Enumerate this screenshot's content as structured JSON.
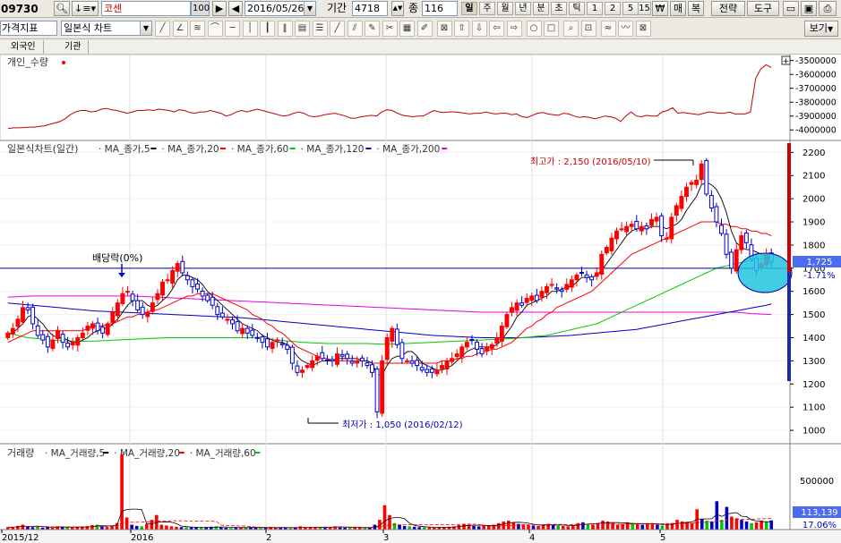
{
  "toolbar1": {
    "stock_code": "09730",
    "stock_name": "코센",
    "qty": "100",
    "date": "2016/05/26",
    "period_label": "기간",
    "period_value": "4718",
    "mid_label": "종",
    "mid_value": "116",
    "periods": [
      "일",
      "주",
      "월",
      "년",
      "분",
      "초",
      "틱",
      "1",
      "2",
      "5",
      "15"
    ],
    "selected_period": "일",
    "currency_btn": "₩",
    "buy_btn": "매",
    "complex_btn": "복",
    "strategy_btn": "전략",
    "tools_btn": "도구"
  },
  "toolbar2": {
    "indicator_label": "가격지표",
    "chart_type": "일본식 차트",
    "view_btn": "보기"
  },
  "tabs": [
    "외국인",
    "기관"
  ],
  "top_panel": {
    "legend": "개인_수량",
    "axis_labels": [
      "-3500000",
      "-3600000",
      "-3700000",
      "-3800000",
      "-3900000",
      "-4000000"
    ],
    "y_range": [
      -4050000,
      -3470000
    ],
    "series": [
      -3990000,
      -3985000,
      -3985000,
      -3983000,
      -3980000,
      -3980000,
      -3975000,
      -3970000,
      -3960000,
      -3950000,
      -3940000,
      -3920000,
      -3890000,
      -3870000,
      -3860000,
      -3860000,
      -3870000,
      -3865000,
      -3850000,
      -3845000,
      -3855000,
      -3860000,
      -3870000,
      -3880000,
      -3870000,
      -3860000,
      -3860000,
      -3855000,
      -3860000,
      -3850000,
      -3855000,
      -3860000,
      -3870000,
      -3855000,
      -3860000,
      -3875000,
      -3880000,
      -3870000,
      -3870000,
      -3860000,
      -3870000,
      -3880000,
      -3900000,
      -3890000,
      -3870000,
      -3860000,
      -3870000,
      -3860000,
      -3850000,
      -3860000,
      -3870000,
      -3880000,
      -3890000,
      -3900000,
      -3895000,
      -3880000,
      -3870000,
      -3880000,
      -3900000,
      -3905000,
      -3900000,
      -3890000,
      -3885000,
      -3880000,
      -3890000,
      -3900000,
      -3915000,
      -3915000,
      -3905000,
      -3900000,
      -3895000,
      -3900000,
      -3870000,
      -3855000,
      -3860000,
      -3880000,
      -3895000,
      -3900000,
      -3905000,
      -3900000,
      -3900000,
      -3880000,
      -3860000,
      -3870000,
      -3875000,
      -3870000,
      -3870000,
      -3875000,
      -3880000,
      -3885000,
      -3880000,
      -3880000,
      -3870000,
      -3880000,
      -3885000,
      -3880000,
      -3880000,
      -3890000,
      -3885000,
      -3905000,
      -3910000,
      -3895000,
      -3880000,
      -3875000,
      -3885000,
      -3890000,
      -3895000,
      -3880000,
      -3885000,
      -3900000,
      -3910000,
      -3905000,
      -3910000,
      -3920000,
      -3910000,
      -3900000,
      -3905000,
      -3915000,
      -3940000,
      -3900000,
      -3870000,
      -3900000,
      -3905000,
      -3895000,
      -3900000,
      -3900000,
      -3870000,
      -3860000,
      -3840000,
      -3880000,
      -3875000,
      -3880000,
      -3885000,
      -3890000,
      -3880000,
      -3870000,
      -3875000,
      -3880000,
      -3880000,
      -3870000,
      -3885000,
      -3885000,
      -3885000,
      -3870000,
      -3630000,
      -3560000,
      -3530000,
      -3550000
    ]
  },
  "price_panel": {
    "legend_title": "일본식차트(일간)",
    "ma_legend": [
      {
        "name": "MA_종가,5",
        "color": "#000000"
      },
      {
        "name": "MA_종가,20",
        "color": "#ff0000"
      },
      {
        "name": "MA_종가,60",
        "color": "#00c800"
      },
      {
        "name": "MA_종가,120",
        "color": "#0000c8"
      },
      {
        "name": "MA_종가,200",
        "color": "#e000e0"
      }
    ],
    "axis_labels": [
      "2200",
      "2100",
      "2000",
      "1900",
      "1800",
      "1700",
      "1600",
      "1500",
      "1400",
      "1300",
      "1200",
      "1100",
      "1000"
    ],
    "y_range": [
      950,
      2240
    ],
    "current_price": "1,725",
    "current_change": "-1.71%",
    "dividend_label": "배당락(0%)",
    "high_label": "최고가 : 2,150 (2016/05/10)",
    "low_label": "최저가 : 1,050 (2016/02/12)",
    "level_line": 1700
  },
  "volume_panel": {
    "legend_title": "거래량",
    "ma_legend": [
      {
        "name": "MA_거래량,5",
        "color": "#000000"
      },
      {
        "name": "MA_거래량,20",
        "color": "#ff0000"
      },
      {
        "name": "MA_거래량,60",
        "color": "#00c800"
      }
    ],
    "axis_label": "500000",
    "current_volume": "113,139",
    "current_ratio": "17.06%"
  },
  "x_axis": {
    "labels": [
      "2015/12",
      "2016",
      "2",
      "3",
      "4",
      "5"
    ]
  },
  "colors": {
    "up": "#ff0000",
    "down": "#0000c8",
    "ma5": "#000000",
    "ma20": "#ff0000",
    "ma60": "#00c800",
    "ma120": "#0000c8",
    "ma200": "#e000e0",
    "highlight": "#22c4e0"
  },
  "chart_data": {
    "type": "candlestick",
    "x_labels": [
      "2015/12",
      "2016",
      "2",
      "3",
      "4",
      "5"
    ],
    "y_range": [
      950,
      2240
    ],
    "high": {
      "value": 2150,
      "date": "2016/05/10"
    },
    "low": {
      "value": 1050,
      "date": "2016/02/12"
    },
    "close": [
      1420,
      1440,
      1480,
      1530,
      1520,
      1460,
      1410,
      1390,
      1360,
      1390,
      1430,
      1380,
      1360,
      1380,
      1400,
      1420,
      1450,
      1460,
      1430,
      1420,
      1460,
      1510,
      1550,
      1590,
      1600,
      1560,
      1520,
      1500,
      1510,
      1550,
      1590,
      1640,
      1650,
      1690,
      1720,
      1680,
      1650,
      1620,
      1610,
      1580,
      1560,
      1540,
      1500,
      1490,
      1480,
      1460,
      1430,
      1440,
      1420,
      1410,
      1400,
      1380,
      1360,
      1380,
      1390,
      1370,
      1350,
      1290,
      1250,
      1260,
      1280,
      1300,
      1320,
      1310,
      1300,
      1300,
      1330,
      1320,
      1310,
      1290,
      1300,
      1300,
      1280,
      1250,
      1080,
      1300,
      1400,
      1440,
      1370,
      1310,
      1300,
      1290,
      1280,
      1260,
      1250,
      1250,
      1260,
      1280,
      1300,
      1310,
      1330,
      1360,
      1380,
      1390,
      1350,
      1330,
      1360,
      1370,
      1400,
      1450,
      1500,
      1530,
      1550,
      1540,
      1570,
      1580,
      1560,
      1600,
      1620,
      1630,
      1610,
      1600,
      1630,
      1650,
      1670,
      1680,
      1660,
      1650,
      1680,
      1760,
      1790,
      1830,
      1860,
      1870,
      1880,
      1890,
      1870,
      1880,
      1870,
      1910,
      1920,
      1840,
      1830,
      1920,
      1970,
      2010,
      2050,
      2070,
      2080,
      2150,
      2020,
      1960,
      1900,
      1850,
      1760,
      1700,
      1780,
      1840,
      1810,
      1740,
      1690,
      1720,
      1760,
      1725
    ],
    "ma5": [
      1410,
      1420,
      1440,
      1460,
      1490,
      1500,
      1480,
      1460,
      1430,
      1410,
      1400,
      1400,
      1390,
      1380,
      1380,
      1390,
      1400,
      1420,
      1430,
      1440,
      1440,
      1460,
      1480,
      1510,
      1540,
      1560,
      1560,
      1560,
      1540,
      1530,
      1540,
      1560,
      1580,
      1610,
      1650,
      1670,
      1670,
      1660,
      1650,
      1630,
      1600,
      1580,
      1560,
      1540,
      1520,
      1500,
      1480,
      1460,
      1450,
      1440,
      1430,
      1410,
      1400,
      1390,
      1380,
      1380,
      1370,
      1350,
      1320,
      1300,
      1290,
      1280,
      1290,
      1300,
      1300,
      1300,
      1310,
      1310,
      1310,
      1310,
      1310,
      1300,
      1300,
      1290,
      1240,
      1240,
      1280,
      1310,
      1320,
      1320,
      1340,
      1340,
      1320,
      1290,
      1280,
      1270,
      1260,
      1260,
      1270,
      1280,
      1300,
      1320,
      1340,
      1350,
      1360,
      1360,
      1360,
      1360,
      1370,
      1390,
      1420,
      1450,
      1490,
      1510,
      1540,
      1550,
      1560,
      1570,
      1580,
      1600,
      1600,
      1610,
      1620,
      1620,
      1640,
      1660,
      1660,
      1660,
      1670,
      1690,
      1720,
      1750,
      1780,
      1810,
      1840,
      1860,
      1870,
      1870,
      1870,
      1880,
      1880,
      1880,
      1870,
      1880,
      1890,
      1910,
      1950,
      1980,
      2010,
      2060,
      2070,
      2060,
      2040,
      2000,
      1940,
      1860,
      1810,
      1790,
      1780,
      1780,
      1770,
      1760,
      1750,
      1740
    ],
    "ma20": [
      1380,
      1390,
      1400,
      1410,
      1420,
      1430,
      1430,
      1430,
      1430,
      1430,
      1430,
      1430,
      1430,
      1430,
      1430,
      1430,
      1440,
      1450,
      1450,
      1450,
      1460,
      1460,
      1470,
      1480,
      1490,
      1490,
      1500,
      1500,
      1510,
      1520,
      1520,
      1530,
      1540,
      1550,
      1560,
      1570,
      1580,
      1580,
      1590,
      1590,
      1590,
      1590,
      1580,
      1570,
      1560,
      1550,
      1540,
      1530,
      1520,
      1500,
      1490,
      1480,
      1460,
      1450,
      1430,
      1420,
      1400,
      1380,
      1360,
      1350,
      1340,
      1330,
      1320,
      1310,
      1310,
      1300,
      1300,
      1300,
      1300,
      1300,
      1300,
      1300,
      1300,
      1290,
      1290,
      1290,
      1290,
      1290,
      1290,
      1290,
      1290,
      1290,
      1290,
      1290,
      1290,
      1290,
      1290,
      1300,
      1300,
      1300,
      1310,
      1310,
      1320,
      1320,
      1330,
      1340,
      1340,
      1350,
      1350,
      1360,
      1370,
      1380,
      1400,
      1420,
      1440,
      1450,
      1470,
      1480,
      1500,
      1510,
      1530,
      1540,
      1550,
      1560,
      1570,
      1580,
      1590,
      1600,
      1620,
      1640,
      1660,
      1680,
      1700,
      1720,
      1740,
      1760,
      1770,
      1780,
      1790,
      1800,
      1810,
      1820,
      1830,
      1840,
      1850,
      1860,
      1870,
      1880,
      1890,
      1900,
      1900,
      1900,
      1900,
      1890,
      1890,
      1880,
      1880,
      1870,
      1870,
      1860,
      1860,
      1850,
      1850,
      1840
    ],
    "ma60": [
      1420,
      1415,
      1410,
      1405,
      1400,
      1398,
      1396,
      1394,
      1392,
      1390,
      1388,
      1387,
      1386,
      1385,
      1385,
      1385,
      1385,
      1385,
      1386,
      1387,
      1388,
      1389,
      1390,
      1391,
      1392,
      1393,
      1394,
      1395,
      1396,
      1397,
      1398,
      1399,
      1400,
      1400,
      1400,
      1400,
      1400,
      1400,
      1400,
      1400,
      1400,
      1400,
      1400,
      1400,
      1400,
      1400,
      1400,
      1400,
      1400,
      1400,
      1398,
      1396,
      1394,
      1392,
      1390,
      1388,
      1386,
      1384,
      1382,
      1380,
      1379,
      1378,
      1377,
      1376,
      1375,
      1375,
      1375,
      1375,
      1375,
      1375,
      1375,
      1375,
      1375,
      1374,
      1373,
      1372,
      1372,
      1372,
      1373,
      1374,
      1375,
      1376,
      1377,
      1378,
      1379,
      1380,
      1381,
      1382,
      1383,
      1384,
      1385,
      1386,
      1387,
      1388,
      1389,
      1390,
      1391,
      1392,
      1393,
      1394,
      1395,
      1396,
      1398,
      1400,
      1402,
      1404,
      1406,
      1408,
      1410,
      1415,
      1420,
      1425,
      1430,
      1435,
      1440,
      1445,
      1450,
      1455,
      1460,
      1470,
      1480,
      1490,
      1500,
      1510,
      1520,
      1530,
      1540,
      1550,
      1560,
      1570,
      1580,
      1590,
      1600,
      1610,
      1620,
      1630,
      1640,
      1650,
      1660,
      1670,
      1680,
      1690,
      1700,
      1705,
      1710,
      1715,
      1720,
      1725,
      1730,
      1735,
      1740,
      1742,
      1745,
      1750
    ],
    "ma120": [
      1550,
      1548,
      1546,
      1544,
      1542,
      1540,
      1538,
      1536,
      1534,
      1532,
      1530,
      1528,
      1526,
      1524,
      1522,
      1520,
      1518,
      1516,
      1515,
      1514,
      1513,
      1512,
      1511,
      1510,
      1509,
      1508,
      1507,
      1506,
      1505,
      1504,
      1503,
      1502,
      1501,
      1500,
      1499,
      1498,
      1497,
      1496,
      1495,
      1494,
      1493,
      1492,
      1491,
      1490,
      1489,
      1488,
      1487,
      1486,
      1484,
      1482,
      1480,
      1478,
      1476,
      1474,
      1472,
      1470,
      1468,
      1466,
      1464,
      1462,
      1460,
      1458,
      1456,
      1454,
      1452,
      1450,
      1448,
      1446,
      1444,
      1442,
      1440,
      1438,
      1436,
      1434,
      1432,
      1430,
      1428,
      1426,
      1424,
      1422,
      1420,
      1418,
      1416,
      1414,
      1412,
      1410,
      1409,
      1408,
      1407,
      1406,
      1405,
      1404,
      1403,
      1402,
      1401,
      1400,
      1400,
      1400,
      1400,
      1400,
      1400,
      1400,
      1400,
      1400,
      1401,
      1402,
      1403,
      1404,
      1405,
      1406,
      1407,
      1408,
      1409,
      1410,
      1412,
      1414,
      1416,
      1418,
      1420,
      1422,
      1424,
      1426,
      1428,
      1430,
      1432,
      1434,
      1436,
      1440,
      1444,
      1448,
      1452,
      1456,
      1460,
      1464,
      1468,
      1472,
      1476,
      1480,
      1484,
      1488,
      1492,
      1496,
      1500,
      1504,
      1508,
      1512,
      1516,
      1520,
      1524,
      1528,
      1532,
      1536,
      1540,
      1545
    ],
    "ma200": [
      1575,
      1576,
      1577,
      1578,
      1579,
      1580,
      1580,
      1580,
      1580,
      1580,
      1580,
      1580,
      1580,
      1580,
      1580,
      1580,
      1580,
      1580,
      1580,
      1580,
      1580,
      1580,
      1580,
      1580,
      1580,
      1580,
      1579,
      1578,
      1577,
      1576,
      1575,
      1574,
      1573,
      1572,
      1571,
      1570,
      1569,
      1568,
      1567,
      1566,
      1565,
      1564,
      1563,
      1562,
      1561,
      1560,
      1559,
      1558,
      1557,
      1556,
      1555,
      1554,
      1553,
      1552,
      1551,
      1550,
      1549,
      1548,
      1547,
      1546,
      1545,
      1544,
      1543,
      1542,
      1541,
      1540,
      1539,
      1538,
      1537,
      1536,
      1535,
      1534,
      1533,
      1532,
      1531,
      1530,
      1529,
      1528,
      1527,
      1526,
      1525,
      1524,
      1523,
      1522,
      1521,
      1520,
      1519,
      1518,
      1517,
      1516,
      1515,
      1514,
      1513,
      1512,
      1511,
      1510,
      1510,
      1510,
      1510,
      1510,
      1510,
      1510,
      1510,
      1510,
      1510,
      1510,
      1510,
      1510,
      1510,
      1510,
      1510,
      1510,
      1510,
      1510,
      1510,
      1510,
      1510,
      1510,
      1510,
      1510,
      1510,
      1510,
      1510,
      1510,
      1510,
      1510,
      1510,
      1510,
      1510,
      1510,
      1510,
      1510,
      1510,
      1510,
      1510,
      1510,
      1510,
      1510,
      1510,
      1510,
      1510,
      1510,
      1510,
      1510,
      1510,
      1510,
      1510,
      1508,
      1506,
      1504,
      1503,
      1502,
      1501,
      1500
    ],
    "volume": [
      30000,
      28000,
      45000,
      60000,
      35000,
      30000,
      40000,
      25000,
      30000,
      22000,
      40000,
      35000,
      28000,
      25000,
      30000,
      38000,
      42000,
      55000,
      60000,
      40000,
      30000,
      45000,
      80000,
      930000,
      150000,
      60000,
      45000,
      40000,
      70000,
      120000,
      180000,
      60000,
      50000,
      40000,
      35000,
      30000,
      28000,
      26000,
      25000,
      24000,
      30000,
      35000,
      40000,
      25000,
      22000,
      20000,
      24000,
      28000,
      26000,
      30000,
      22000,
      20000,
      24000,
      30000,
      26000,
      28000,
      22000,
      18000,
      25000,
      40000,
      30000,
      26000,
      24000,
      30000,
      35000,
      28000,
      40000,
      30000,
      25000,
      28000,
      26000,
      22000,
      20000,
      24000,
      60000,
      120000,
      300000,
      180000,
      80000,
      60000,
      45000,
      40000,
      35000,
      30000,
      28000,
      26000,
      25000,
      28000,
      30000,
      35000,
      40000,
      55000,
      70000,
      60000,
      45000,
      40000,
      50000,
      55000,
      60000,
      80000,
      100000,
      110000,
      90000,
      70000,
      65000,
      55000,
      50000,
      45000,
      60000,
      70000,
      55000,
      50000,
      45000,
      40000,
      60000,
      80000,
      90000,
      70000,
      60000,
      80000,
      110000,
      100000,
      80000,
      60000,
      70000,
      90000,
      80000,
      70000,
      60000,
      70000,
      80000,
      60000,
      50000,
      60000,
      80000,
      120000,
      100000,
      90000,
      80000,
      250000,
      130000,
      110000,
      100000,
      350000,
      120000,
      280000,
      160000,
      140000,
      120000,
      100000,
      80000,
      90000,
      110000,
      100000,
      113139
    ]
  }
}
